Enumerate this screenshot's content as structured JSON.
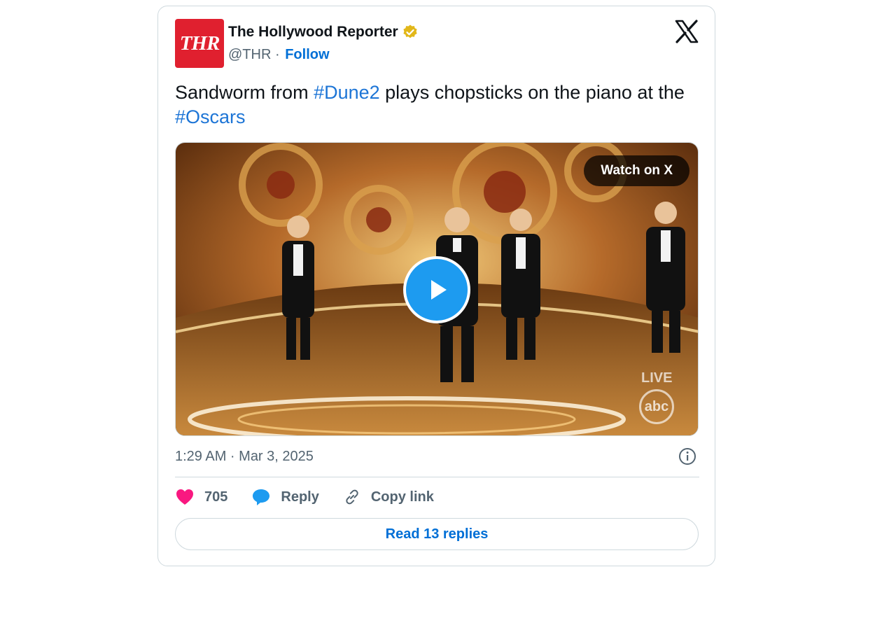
{
  "account": {
    "avatar_text": "THR",
    "name": "The Hollywood Reporter",
    "handle": "@THR",
    "separator": "·",
    "follow_label": "Follow"
  },
  "tweet": {
    "text_part1": "Sandworm from ",
    "hashtag1": "#Dune2",
    "text_part2": " plays chopsticks on the piano at the ",
    "hashtag2": "#Oscars"
  },
  "media": {
    "watch_label": "Watch on X",
    "live_label": "LIVE",
    "network_logo": "abc"
  },
  "timestamp": "1:29 AM · Mar 3, 2025",
  "actions": {
    "like_count": "705",
    "reply_label": "Reply",
    "copy_link_label": "Copy link"
  },
  "read_replies_label": "Read 13 replies",
  "colors": {
    "brand_red": "#e0202f",
    "link_blue": "#006fd6",
    "hashtag_blue": "#1d75d6",
    "like_pink": "#f91880",
    "reply_blue": "#1d9bf0"
  },
  "icons": [
    "verified-badge-icon",
    "x-logo-icon",
    "play-icon",
    "info-icon",
    "heart-icon",
    "reply-bubble-icon",
    "link-icon"
  ]
}
